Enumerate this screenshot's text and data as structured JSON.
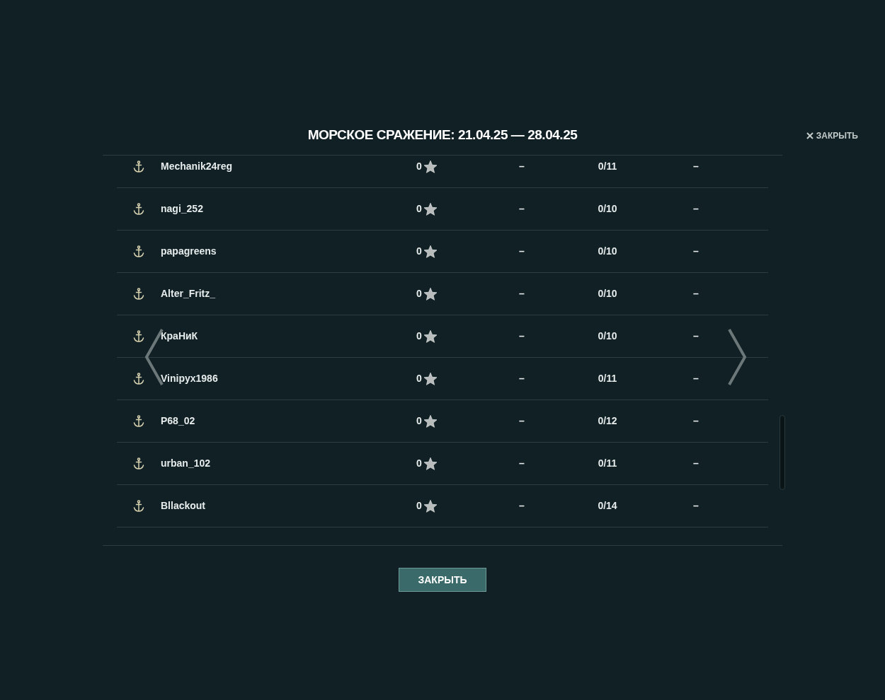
{
  "dialog": {
    "title": "МОРСКОЕ СРАЖЕНИЕ: 21.04.25 — 28.04.25",
    "close_link": "ЗАКРЫТЬ",
    "close_button": "ЗАКРЫТЬ"
  },
  "rows": [
    {
      "name": "Mechanik24reg",
      "score": "0",
      "column_3": "–",
      "column_4": "0/11",
      "column_5": "–"
    },
    {
      "name": "nagi_252",
      "score": "0",
      "column_3": "–",
      "column_4": "0/10",
      "column_5": "–"
    },
    {
      "name": "papagreens",
      "score": "0",
      "column_3": "–",
      "column_4": "0/10",
      "column_5": "–"
    },
    {
      "name": "Alter_Fritz_",
      "score": "0",
      "column_3": "–",
      "column_4": "0/10",
      "column_5": "–"
    },
    {
      "name": "КраНиК",
      "score": "0",
      "column_3": "–",
      "column_4": "0/10",
      "column_5": "–"
    },
    {
      "name": "Vinipyx1986",
      "score": "0",
      "column_3": "–",
      "column_4": "0/11",
      "column_5": "–"
    },
    {
      "name": "P68_02",
      "score": "0",
      "column_3": "–",
      "column_4": "0/12",
      "column_5": "–"
    },
    {
      "name": "urban_102",
      "score": "0",
      "column_3": "–",
      "column_4": "0/11",
      "column_5": "–"
    },
    {
      "name": "Bllackout",
      "score": "0",
      "column_3": "–",
      "column_4": "0/14",
      "column_5": "–"
    }
  ]
}
